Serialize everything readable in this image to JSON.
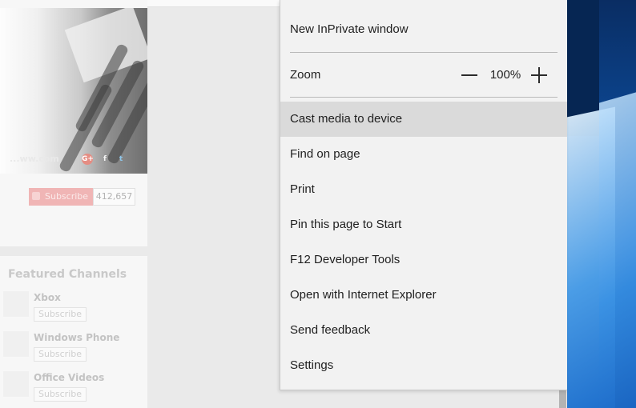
{
  "background_page": {
    "site_watermark": "...ww.com",
    "social": {
      "google": "G+",
      "facebook": "f",
      "twitter": "t"
    },
    "subscribe_label": "Subscribe",
    "subscriber_count": "412,657",
    "channels_title": "Featured Channels",
    "channels": [
      {
        "name": "Xbox",
        "subscribe_label": "Subscribe"
      },
      {
        "name": "Windows Phone",
        "subscribe_label": "Subscribe"
      },
      {
        "name": "Office Videos",
        "subscribe_label": "Subscribe"
      }
    ]
  },
  "menu": {
    "new_inprivate": "New InPrivate window",
    "zoom": {
      "label": "Zoom",
      "value": "100%"
    },
    "items": [
      "Cast media to device",
      "Find on page",
      "Print",
      "Pin this page to Start",
      "F12 Developer Tools",
      "Open with Internet Explorer",
      "Send feedback",
      "Settings"
    ],
    "highlighted_index": 0,
    "highlight_color": "#dadada"
  },
  "colors": {
    "menu_bg": "#f2f2f2",
    "wallpaper": "#0f63c4",
    "subscribe": "#f0b5b5"
  }
}
